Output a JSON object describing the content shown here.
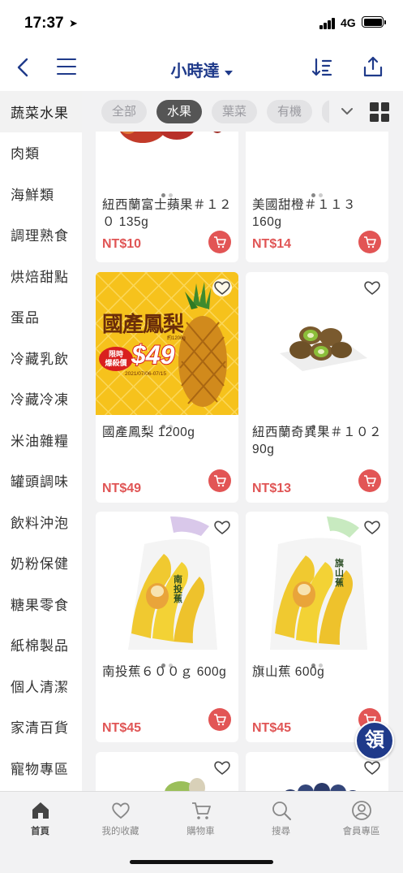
{
  "status_bar": {
    "time": "17:37",
    "network": "4G"
  },
  "nav": {
    "title": "小時達"
  },
  "sidebar": {
    "items": [
      {
        "label": "蔬菜水果"
      },
      {
        "label": "肉類"
      },
      {
        "label": "海鮮類"
      },
      {
        "label": "調理熟食"
      },
      {
        "label": "烘焙甜點"
      },
      {
        "label": "蛋品"
      },
      {
        "label": "冷藏乳飲"
      },
      {
        "label": "冷藏冷凍"
      },
      {
        "label": "米油雜糧"
      },
      {
        "label": "罐頭調味"
      },
      {
        "label": "飲料沖泡"
      },
      {
        "label": "奶粉保健"
      },
      {
        "label": "糖果零食"
      },
      {
        "label": "紙棉製品"
      },
      {
        "label": "個人清潔"
      },
      {
        "label": "家清百貨"
      },
      {
        "label": "寵物專區"
      }
    ]
  },
  "filters": {
    "chips": [
      {
        "label": "全部"
      },
      {
        "label": "水果"
      },
      {
        "label": "葉菜"
      },
      {
        "label": "有機"
      }
    ],
    "selected": "水果"
  },
  "products": [
    {
      "name": "紐西蘭富士蘋果＃１２０ 135g",
      "price": "NT$10"
    },
    {
      "name": "美國甜橙＃１１３ 160g",
      "price": "NT$14"
    },
    {
      "name": "國產鳳梨 1200g",
      "price": "NT$49"
    },
    {
      "name": "紐西蘭奇異果＃１０２ 90g",
      "price": "NT$13"
    },
    {
      "name": "南投蕉６００ｇ 600g",
      "price": "NT$45"
    },
    {
      "name": "旗山蕉 600g",
      "price": "NT$45"
    }
  ],
  "promo": {
    "headline": "國產鳳梨",
    "weight": "約1200g",
    "badge_line1": "限時",
    "badge_line2": "爆殺價",
    "price": "$49",
    "dates": "2021/07/06-07/15"
  },
  "banana_labels": {
    "nantou": "南投蕉",
    "qishan": "旗山蕉"
  },
  "coupon": {
    "label": "領"
  },
  "tabbar": {
    "items": [
      {
        "label": "首頁",
        "icon": "home-icon"
      },
      {
        "label": "我的收藏",
        "icon": "heart-icon"
      },
      {
        "label": "購物車",
        "icon": "cart-icon"
      },
      {
        "label": "搜尋",
        "icon": "search-icon"
      },
      {
        "label": "會員專區",
        "icon": "user-icon"
      }
    ]
  },
  "colors": {
    "brand": "#1f3a8a",
    "price": "#e05555",
    "cart_button": "#e25555"
  }
}
